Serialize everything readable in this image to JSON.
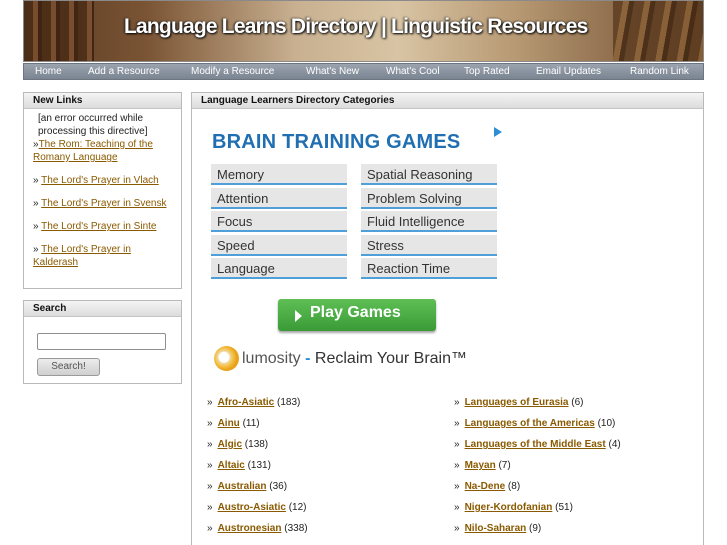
{
  "header": {
    "title": "Language Learns Directory | Linguistic Resources"
  },
  "nav": [
    {
      "label": "Home"
    },
    {
      "label": "Add a Resource"
    },
    {
      "label": "Modify a Resource"
    },
    {
      "label": "What's New"
    },
    {
      "label": "What's Cool"
    },
    {
      "label": "Top Rated"
    },
    {
      "label": "Email Updates"
    },
    {
      "label": "Random Link"
    }
  ],
  "new_links": {
    "title": "New Links",
    "error": "[an error occurred while processing this directive]",
    "items": [
      {
        "label": "The Rom: Teaching of the Romany Language"
      },
      {
        "label": "The Lord's Prayer in Vlach"
      },
      {
        "label": "The Lord's Prayer in Svensk"
      },
      {
        "label": "The Lord's Prayer in Sinte"
      },
      {
        "label": "The Lord's Prayer in Kalderash"
      }
    ]
  },
  "search": {
    "title": "Search",
    "input_value": "",
    "button_label": "Search!"
  },
  "main": {
    "title": "Language Learners Directory Categories"
  },
  "ad": {
    "title": "BRAIN TRAINING GAMES",
    "left_items": [
      "Memory",
      "Attention",
      "Focus",
      "Speed",
      "Language"
    ],
    "right_items": [
      "Spatial Reasoning",
      "Problem Solving",
      "Fluid Intelligence",
      "Stress",
      "Reaction Time"
    ],
    "button_label": "Play Games",
    "brand": "lumosity",
    "dash": "-",
    "tagline": "Reclaim Your Brain™"
  },
  "categories": {
    "left": [
      {
        "name": "Afro-Asiatic",
        "count": "(183)"
      },
      {
        "name": "Ainu",
        "count": "(11)"
      },
      {
        "name": "Algic",
        "count": "(138)"
      },
      {
        "name": "Altaic",
        "count": "(131)"
      },
      {
        "name": "Australian",
        "count": "(36)"
      },
      {
        "name": "Austro-Asiatic",
        "count": "(12)"
      },
      {
        "name": "Austronesian",
        "count": "(338)"
      }
    ],
    "right": [
      {
        "name": "Languages of Eurasia",
        "count": "(6)"
      },
      {
        "name": "Languages of the Americas",
        "count": "(10)"
      },
      {
        "name": "Languages of the Middle East",
        "count": "(4)"
      },
      {
        "name": "Mayan",
        "count": "(7)"
      },
      {
        "name": "Na-Dene",
        "count": "(8)"
      },
      {
        "name": "Niger-Kordofanian",
        "count": "(51)"
      },
      {
        "name": "Nilo-Saharan",
        "count": "(9)"
      }
    ]
  }
}
